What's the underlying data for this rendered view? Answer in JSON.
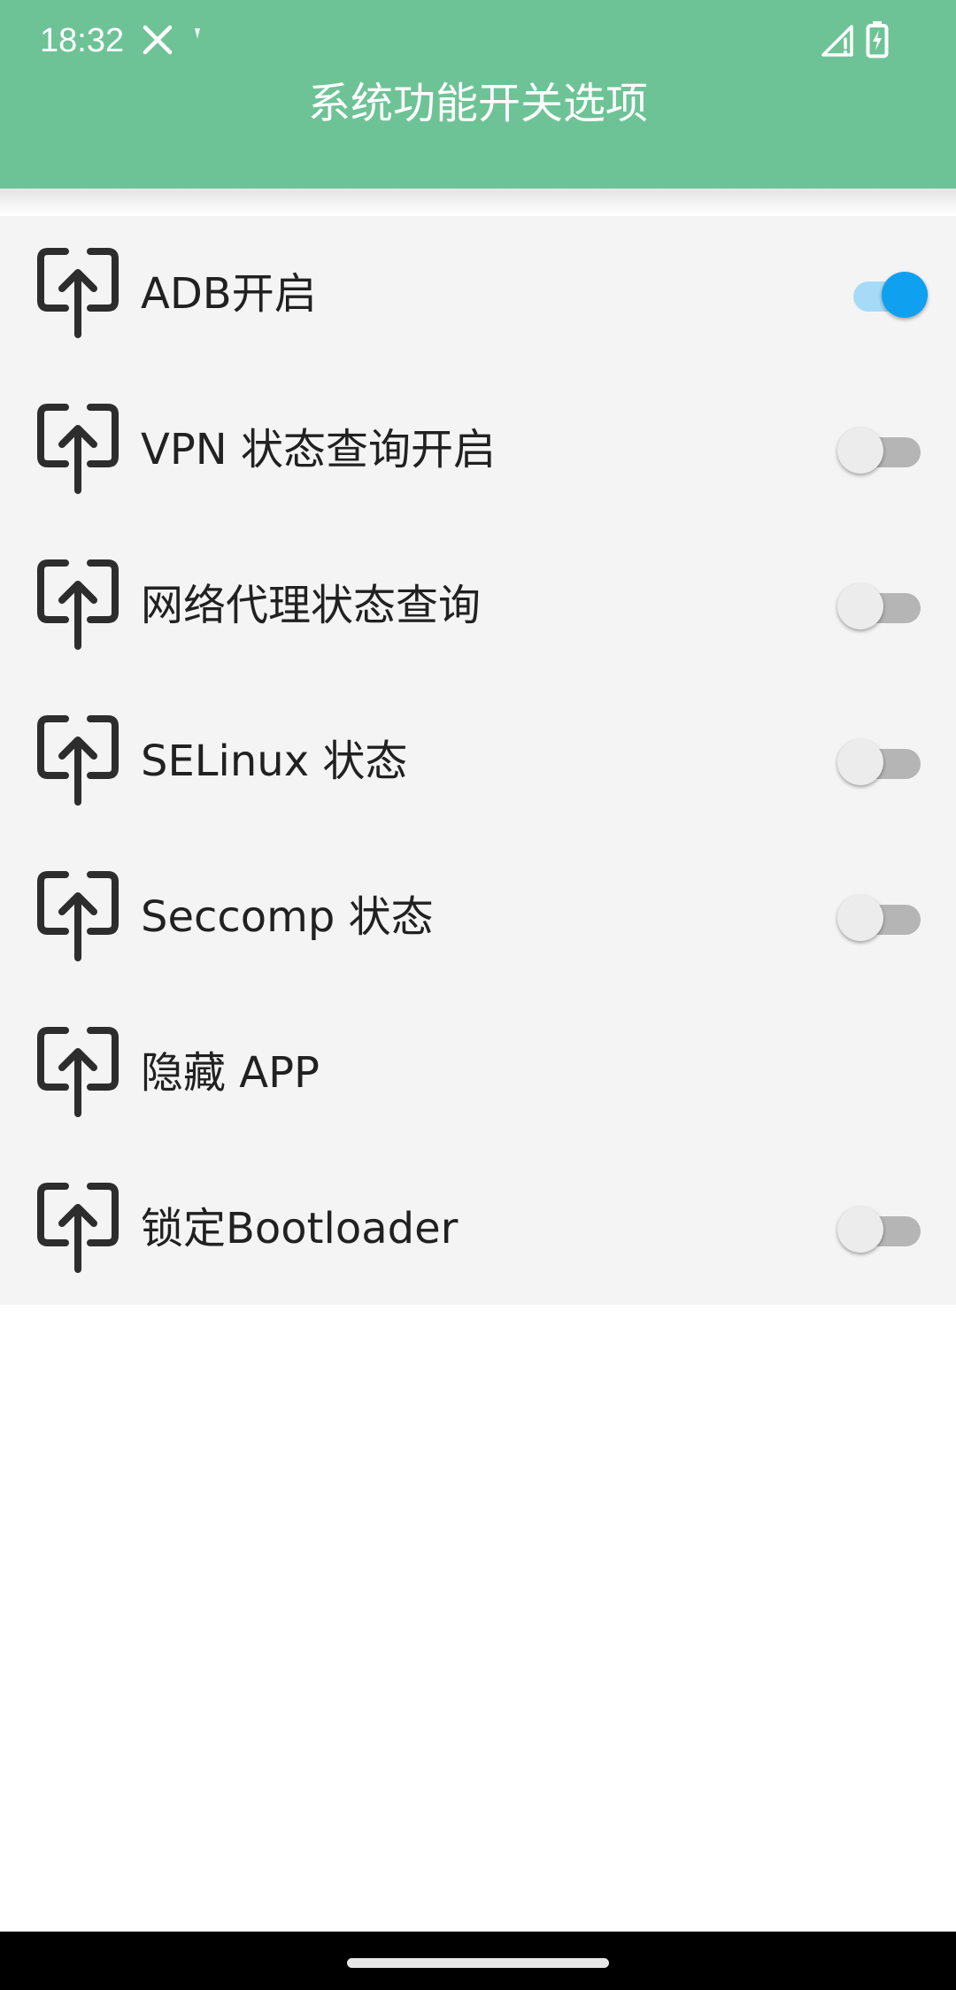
{
  "status_bar": {
    "time": "18:32",
    "icons": [
      "close-icon",
      "dot-icon",
      "signal-icon",
      "battery-charging-icon"
    ]
  },
  "header": {
    "title": "系统功能开关选项",
    "color": "#6ec396"
  },
  "items": [
    {
      "label": "ADB开启",
      "icon": "upload-icon",
      "switch": "on"
    },
    {
      "label": "VPN 状态查询开启",
      "icon": "upload-icon",
      "switch": "off"
    },
    {
      "label": "网络代理状态查询",
      "icon": "upload-icon",
      "switch": "off"
    },
    {
      "label": "SELinux 状态",
      "icon": "upload-icon",
      "switch": "off"
    },
    {
      "label": "Seccomp 状态",
      "icon": "upload-icon",
      "switch": "off"
    },
    {
      "label": "隐藏 APP",
      "icon": "upload-icon",
      "switch": "none"
    },
    {
      "label": "锁定Bootloader",
      "icon": "upload-icon",
      "switch": "off"
    }
  ],
  "colors": {
    "switch_on": "#0fa1ef",
    "list_background": "#f4f4f4"
  }
}
